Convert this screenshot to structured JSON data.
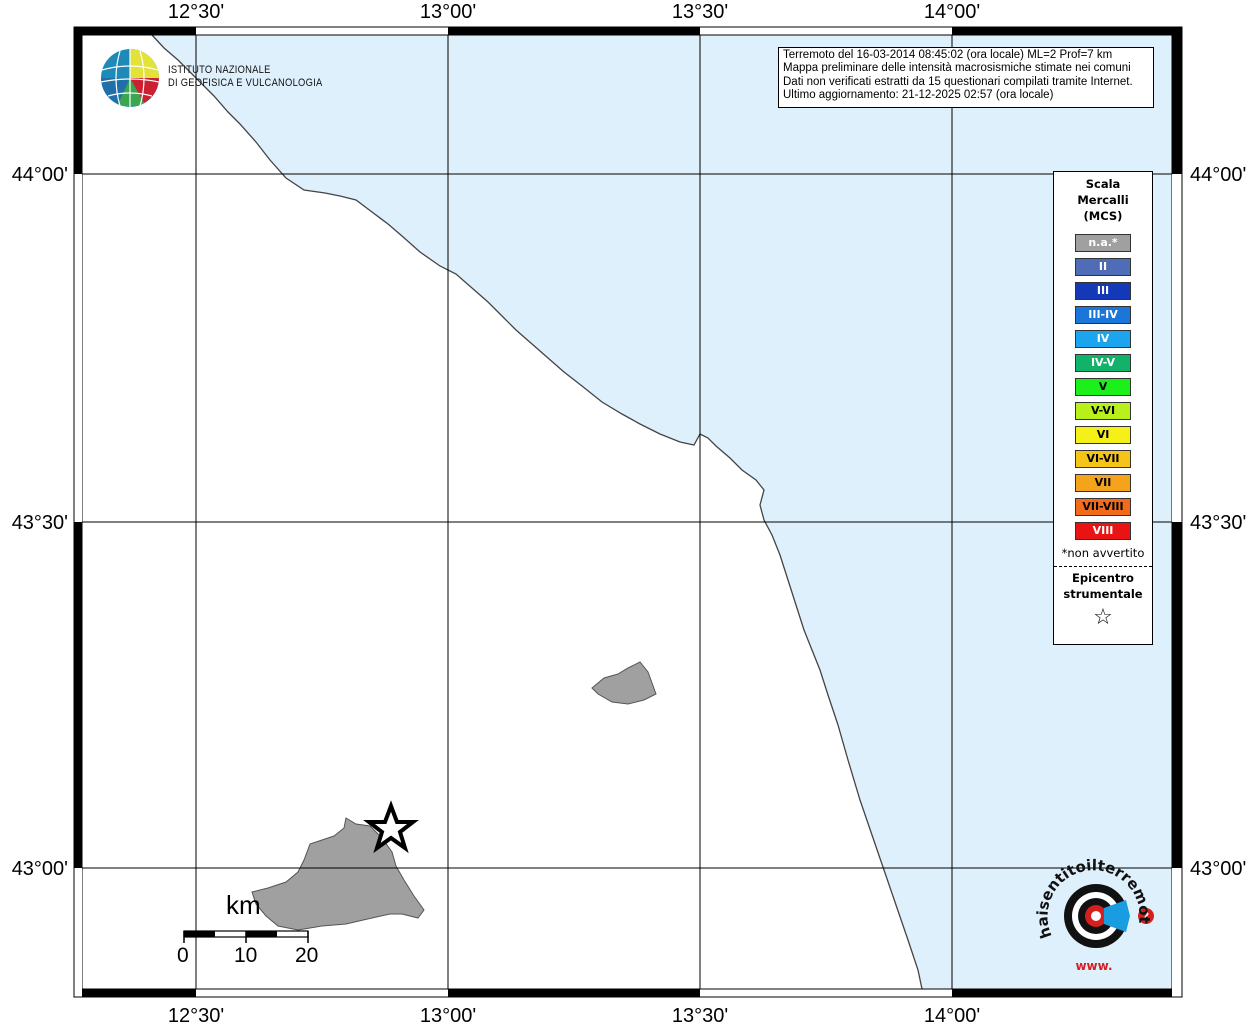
{
  "map": {
    "longitude_labels": [
      "12°30'",
      "13°00'",
      "13°30'",
      "14°00'"
    ],
    "latitude_labels": [
      "44°00'",
      "43°30'",
      "43°00'"
    ],
    "colors": {
      "sea": "#dff0fd",
      "land": "#ffffff",
      "municipality_fill": "#a0a0a0",
      "grid": "#000000"
    }
  },
  "info": {
    "line1": "Terremoto del 16-03-2014 08:45:02 (ora locale) ML=2 Prof=7 km",
    "line2": "Mappa preliminare delle intensità macrosismiche stimate nei comuni",
    "line3": "Dati non verificati estratti da 15 questionari compilati tramite Internet.",
    "line4": "Ultimo aggiornamento: 21-12-2025 02:57 (ora locale)"
  },
  "institute": {
    "line1": "ISTITUTO NAZIONALE",
    "line2": "DI GEOFISICA E VULCANOLOGIA"
  },
  "legend": {
    "title1": "Scala",
    "title2": "Mercalli",
    "title3": "(MCS)",
    "items": [
      {
        "label": "n.a.*",
        "color": "#a0a0a0"
      },
      {
        "label": "II",
        "color": "#4f6db7"
      },
      {
        "label": "III",
        "color": "#1339b8"
      },
      {
        "label": "III-IV",
        "color": "#1a76d8"
      },
      {
        "label": "IV",
        "color": "#1aa5ee"
      },
      {
        "label": "IV-V",
        "color": "#13b26b"
      },
      {
        "label": "V",
        "color": "#1bf01b"
      },
      {
        "label": "V-VI",
        "color": "#b8f01b"
      },
      {
        "label": "VI",
        "color": "#f4f018"
      },
      {
        "label": "VI-VII",
        "color": "#f4c418"
      },
      {
        "label": "VII",
        "color": "#f5a31b"
      },
      {
        "label": "VII-VIII",
        "color": "#f26b1b"
      },
      {
        "label": "VIII",
        "color": "#ea1313"
      }
    ],
    "note": "*non avvertito",
    "epicenter1": "Epicentro",
    "epicenter2": "strumentale",
    "epicenter_symbol": "☆"
  },
  "scale_bar": {
    "unit": "km",
    "labels": [
      "0",
      "10",
      "20"
    ]
  },
  "site_logo": {
    "text": "haisentitoilterremoto.it",
    "prefix": "www."
  }
}
